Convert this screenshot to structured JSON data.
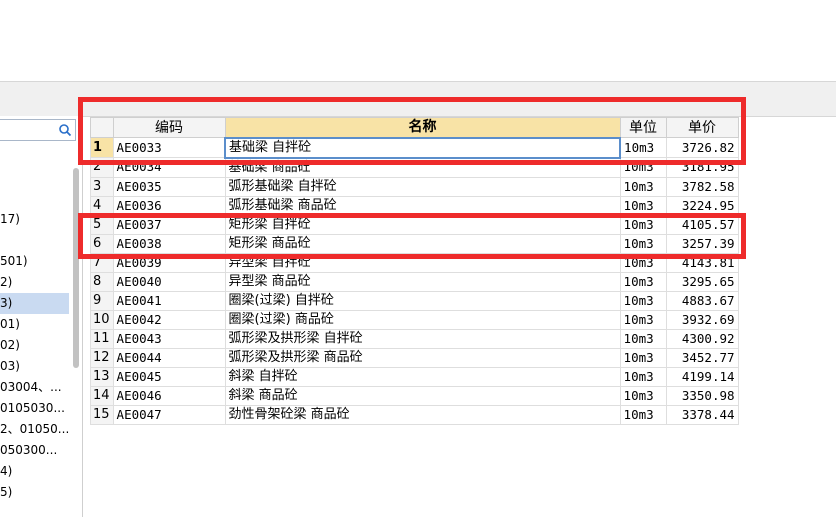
{
  "tree": {
    "items": [
      {
        "label": ""
      },
      {
        "label": ""
      },
      {
        "label": ""
      },
      {
        "label": "17)"
      },
      {
        "label": ""
      },
      {
        "label": "501)"
      },
      {
        "label": "2)"
      },
      {
        "label": "3)",
        "selected": true
      },
      {
        "label": "01)"
      },
      {
        "label": "02)"
      },
      {
        "label": "03)"
      },
      {
        "label": "03004、..."
      },
      {
        "label": "0105030..."
      },
      {
        "label": "2、01050..."
      },
      {
        "label": "050300..."
      },
      {
        "label": "4)"
      },
      {
        "label": "5)"
      }
    ]
  },
  "grid": {
    "headers": {
      "code": "编码",
      "name": "名称",
      "unit": "单位",
      "price": "单价"
    },
    "rows": [
      {
        "n": "1",
        "code": "AE0033",
        "name": "基础梁 自拌砼",
        "unit": "10m3",
        "price": "3726.82"
      },
      {
        "n": "2",
        "code": "AE0034",
        "name": "基础梁 商品砼",
        "unit": "10m3",
        "price": "3181.95"
      },
      {
        "n": "3",
        "code": "AE0035",
        "name": "弧形基础梁 自拌砼",
        "unit": "10m3",
        "price": "3782.58"
      },
      {
        "n": "4",
        "code": "AE0036",
        "name": "弧形基础梁 商品砼",
        "unit": "10m3",
        "price": "3224.95"
      },
      {
        "n": "5",
        "code": "AE0037",
        "name": "矩形梁 自拌砼",
        "unit": "10m3",
        "price": "4105.57"
      },
      {
        "n": "6",
        "code": "AE0038",
        "name": "矩形梁 商品砼",
        "unit": "10m3",
        "price": "3257.39"
      },
      {
        "n": "7",
        "code": "AE0039",
        "name": "异型梁 自拌砼",
        "unit": "10m3",
        "price": "4143.81"
      },
      {
        "n": "8",
        "code": "AE0040",
        "name": "异型梁 商品砼",
        "unit": "10m3",
        "price": "3295.65"
      },
      {
        "n": "9",
        "code": "AE0041",
        "name": "圈梁(过梁) 自拌砼",
        "unit": "10m3",
        "price": "4883.67"
      },
      {
        "n": "10",
        "code": "AE0042",
        "name": "圈梁(过梁) 商品砼",
        "unit": "10m3",
        "price": "3932.69"
      },
      {
        "n": "11",
        "code": "AE0043",
        "name": "弧形梁及拱形梁 自拌砼",
        "unit": "10m3",
        "price": "4300.92"
      },
      {
        "n": "12",
        "code": "AE0044",
        "name": "弧形梁及拱形梁 商品砼",
        "unit": "10m3",
        "price": "3452.77"
      },
      {
        "n": "13",
        "code": "AE0045",
        "name": "斜梁 自拌砼",
        "unit": "10m3",
        "price": "4199.14"
      },
      {
        "n": "14",
        "code": "AE0046",
        "name": "斜梁 商品砼",
        "unit": "10m3",
        "price": "3350.98"
      },
      {
        "n": "15",
        "code": "AE0047",
        "name": "劲性骨架砼梁 商品砼",
        "unit": "10m3",
        "price": "3378.44"
      }
    ]
  },
  "colors": {
    "highlight": "#ee2b2b",
    "selected_header": "#f8e3a6",
    "tree_selected": "#c9daf1"
  }
}
